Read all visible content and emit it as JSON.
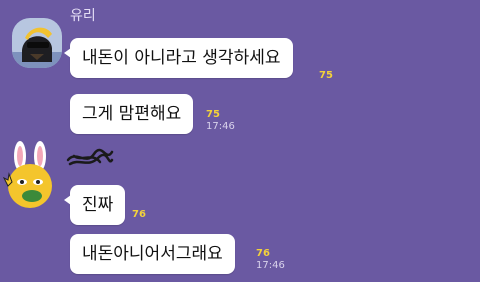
{
  "theme": {
    "background": "#6a59a2",
    "bubble": "#ffffff",
    "unread_color": "#f3d23b",
    "meta_color": "#d9d3ec"
  },
  "conversation": {
    "groups": [
      {
        "sender_name": "유리",
        "avatar_icon": "sunglasses-character-avatar",
        "messages": [
          {
            "text": "내돈이 아니라고 생각하세요",
            "unread": "75",
            "time": ""
          },
          {
            "text": "그게 맘편해요",
            "unread": "75",
            "time": "17:46"
          }
        ]
      },
      {
        "sender_name": "",
        "avatar_icon": "rabbit-character-avatar",
        "messages": [
          {
            "text": "진짜",
            "unread": "76",
            "time": ""
          },
          {
            "text": "내돈아니어서그래요",
            "unread": "76",
            "time": "17:46"
          }
        ]
      }
    ]
  }
}
